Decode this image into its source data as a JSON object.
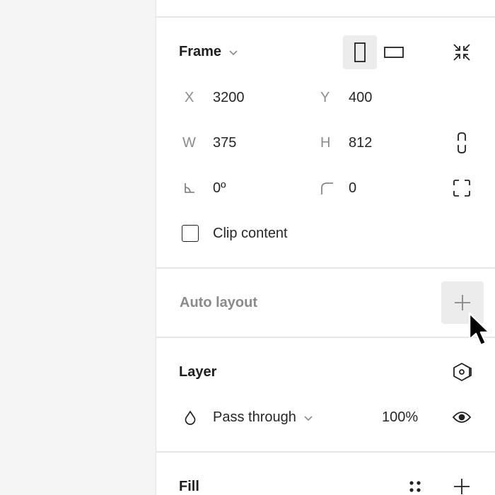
{
  "frame": {
    "title": "Frame",
    "x_label": "X",
    "x_value": "3200",
    "y_label": "Y",
    "y_value": "400",
    "w_label": "W",
    "w_value": "375",
    "h_label": "H",
    "h_value": "812",
    "rotation_value": "0º",
    "radius_value": "0",
    "clip_content_label": "Clip content",
    "clip_content_checked": false,
    "orientation_selected": "portrait"
  },
  "auto_layout": {
    "title": "Auto layout"
  },
  "layer": {
    "title": "Layer",
    "blend_mode": "Pass through",
    "opacity": "100%"
  },
  "fill": {
    "title": "Fill"
  },
  "icons": {
    "frame_dropdown": "chevron-down-icon",
    "portrait": "portrait-frame-icon",
    "landscape": "landscape-frame-icon",
    "resize_to_fit": "collapse-arrows-icon",
    "constrain_proportions": "link-icon",
    "rotation": "angle-icon",
    "corner_radius": "corner-radius-icon",
    "independent_corners": "corners-icon",
    "add_auto_layout": "plus-icon",
    "component": "hexagon-icon",
    "blend": "drop-icon",
    "visibility": "eye-icon",
    "styles": "grid-dots-icon",
    "add_fill": "plus-icon"
  }
}
